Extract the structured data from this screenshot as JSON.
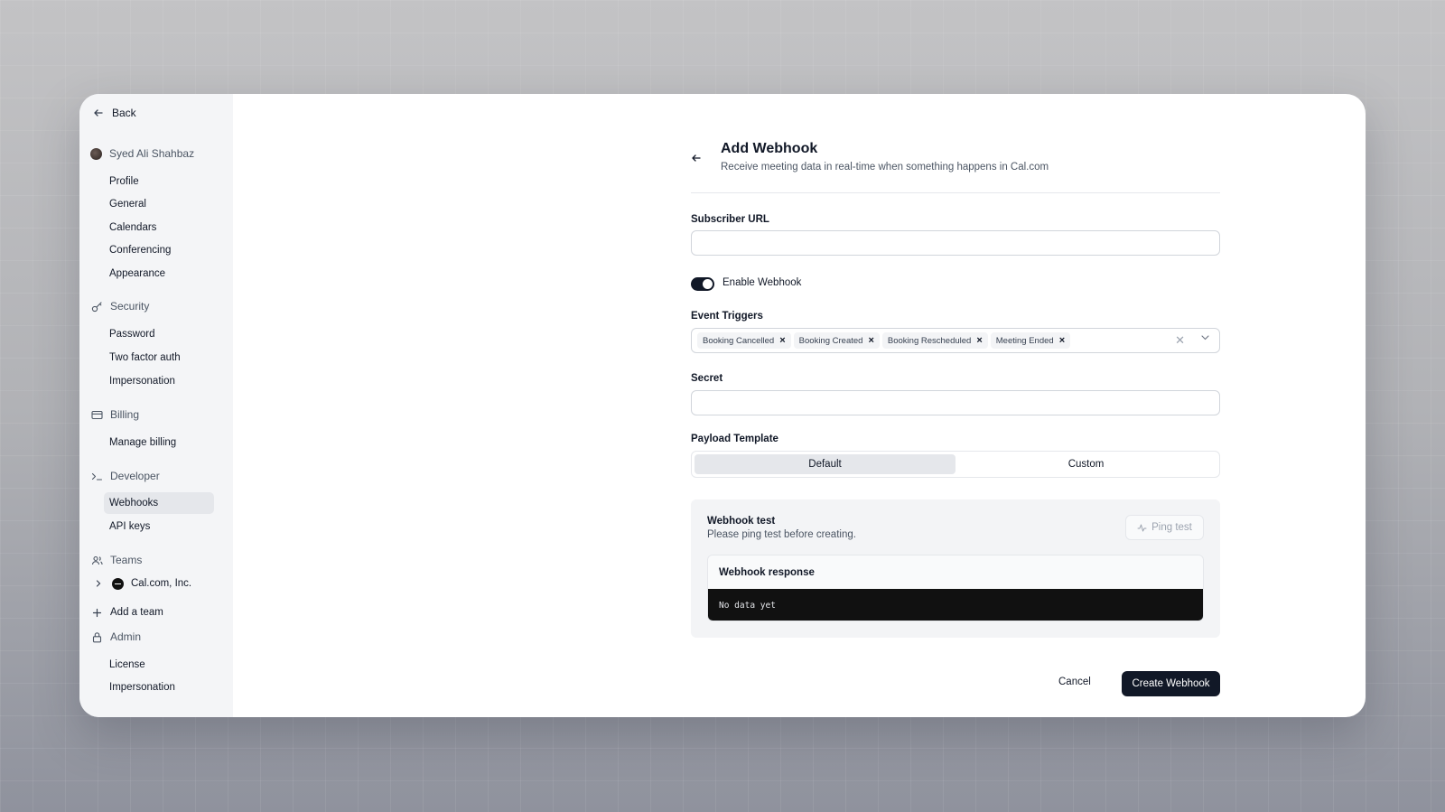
{
  "sidebar": {
    "back_label": "Back",
    "user": {
      "name": "Syed Ali Shahbaz"
    },
    "user_items": [
      "Profile",
      "General",
      "Calendars",
      "Conferencing",
      "Appearance"
    ],
    "security": {
      "label": "Security",
      "items": [
        "Password",
        "Two factor auth",
        "Impersonation"
      ]
    },
    "billing": {
      "label": "Billing",
      "items": [
        "Manage billing"
      ]
    },
    "developer": {
      "label": "Developer",
      "items": [
        "Webhooks",
        "API keys"
      ],
      "active": "Webhooks"
    },
    "teams": {
      "label": "Teams",
      "team_name": "Cal.com, Inc.",
      "add_team_label": "Add a team"
    },
    "admin": {
      "label": "Admin",
      "items": [
        "License",
        "Impersonation"
      ]
    }
  },
  "form": {
    "title": "Add Webhook",
    "subtitle": "Receive meeting data in real-time when something happens in Cal.com",
    "subscriber_url": {
      "label": "Subscriber URL",
      "value": "",
      "placeholder": ""
    },
    "enable_webhook": {
      "label": "Enable Webhook",
      "enabled": true
    },
    "event_triggers": {
      "label": "Event Triggers",
      "selected": [
        "Booking Cancelled",
        "Booking Created",
        "Booking Rescheduled",
        "Meeting Ended"
      ]
    },
    "secret": {
      "label": "Secret",
      "value": "",
      "placeholder": ""
    },
    "payload_template": {
      "label": "Payload Template",
      "options": [
        "Default",
        "Custom"
      ],
      "selected": "Default"
    },
    "webhook_test": {
      "title": "Webhook test",
      "subtitle": "Please ping test before creating.",
      "ping_label": "Ping test",
      "response_title": "Webhook response",
      "response_body": "No data yet"
    },
    "cancel_label": "Cancel",
    "create_label": "Create Webhook"
  },
  "colors": {
    "primary": "#111827",
    "sidebar_bg": "#f4f5f7",
    "active_item": "#e5e7eb",
    "console_bg": "#111111"
  }
}
